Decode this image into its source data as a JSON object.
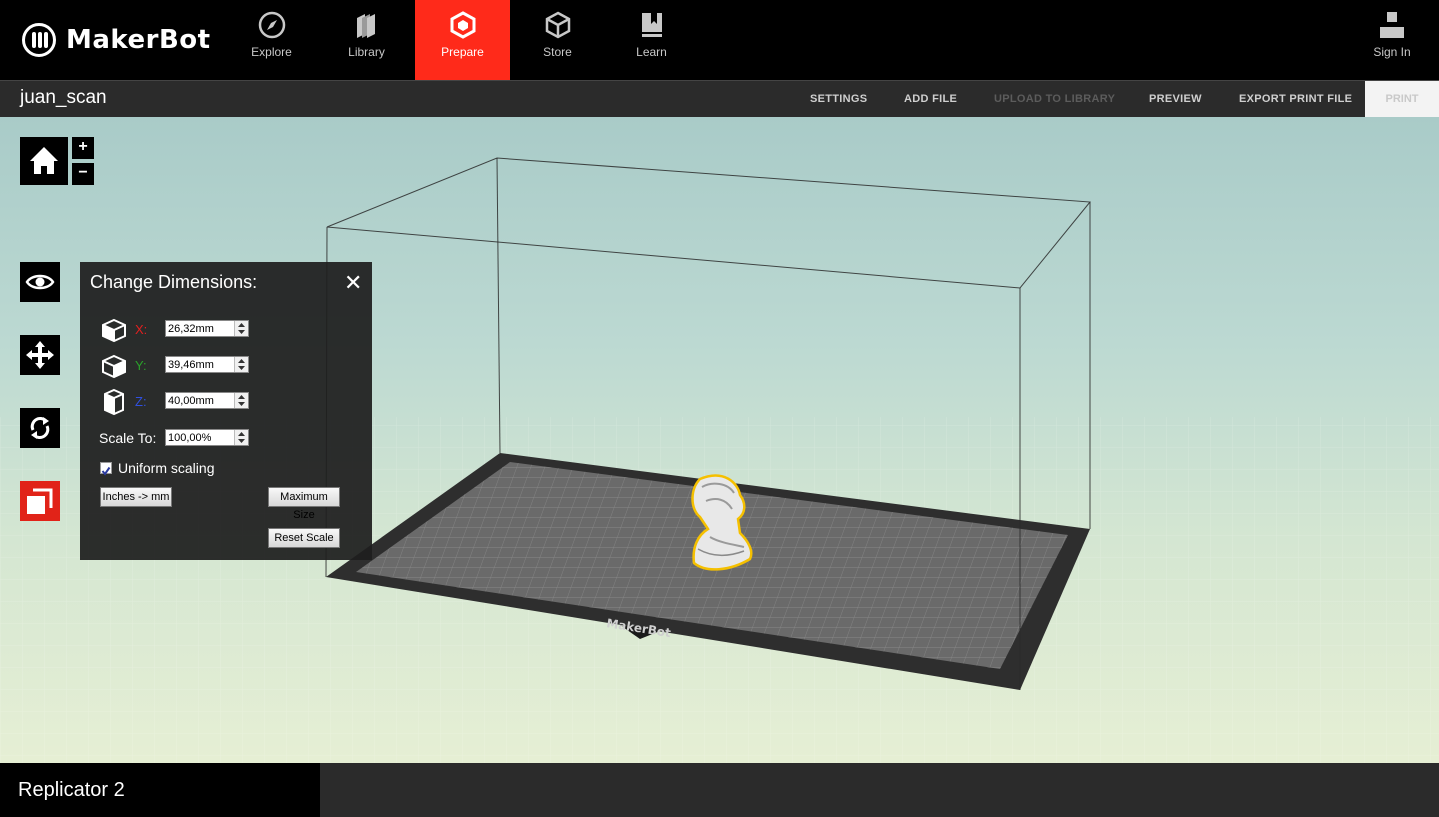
{
  "app": {
    "brand": "MakerBot"
  },
  "nav": {
    "tabs": [
      {
        "label": "Explore",
        "icon": "compass-icon"
      },
      {
        "label": "Library",
        "icon": "library-icon"
      },
      {
        "label": "Prepare",
        "icon": "prepare-cube-icon",
        "active": true
      },
      {
        "label": "Store",
        "icon": "store-box-icon"
      },
      {
        "label": "Learn",
        "icon": "learn-book-icon"
      }
    ],
    "signin": {
      "label": "Sign In",
      "icon": "user-icon"
    }
  },
  "toolbar": {
    "project_name": "juan_scan",
    "settings": "SETTINGS",
    "add_file": "ADD FILE",
    "upload": "UPLOAD TO LIBRARY",
    "preview": "PREVIEW",
    "export": "EXPORT PRINT FILE",
    "print": "PRINT"
  },
  "view_tools": {
    "home": "home-icon",
    "zoom_in": "+",
    "zoom_out": "−",
    "tools": [
      "eye-icon",
      "move-icon",
      "rotate-icon",
      "scale-icon"
    ]
  },
  "dimensions_panel": {
    "title": "Change Dimensions:",
    "close": "✕",
    "x_label": "X:",
    "x_value": "26,32mm",
    "y_label": "Y:",
    "y_value": "39,46mm",
    "z_label": "Z:",
    "z_value": "40,00mm",
    "scale_label": "Scale To:",
    "scale_value": "100,00%",
    "uniform_label": "Uniform scaling",
    "uniform_checked": true,
    "inches_button": "Inches -> mm",
    "max_button": "Maximum Size",
    "reset_button": "Reset Scale"
  },
  "build_plate": {
    "label": "MakerBot"
  },
  "status": {
    "printer": "Replicator 2"
  },
  "colors": {
    "accent": "#ff2a1a",
    "x_axis": "#e02020",
    "y_axis": "#2aa02a",
    "z_axis": "#3050e0",
    "selection": "#f5c000"
  }
}
